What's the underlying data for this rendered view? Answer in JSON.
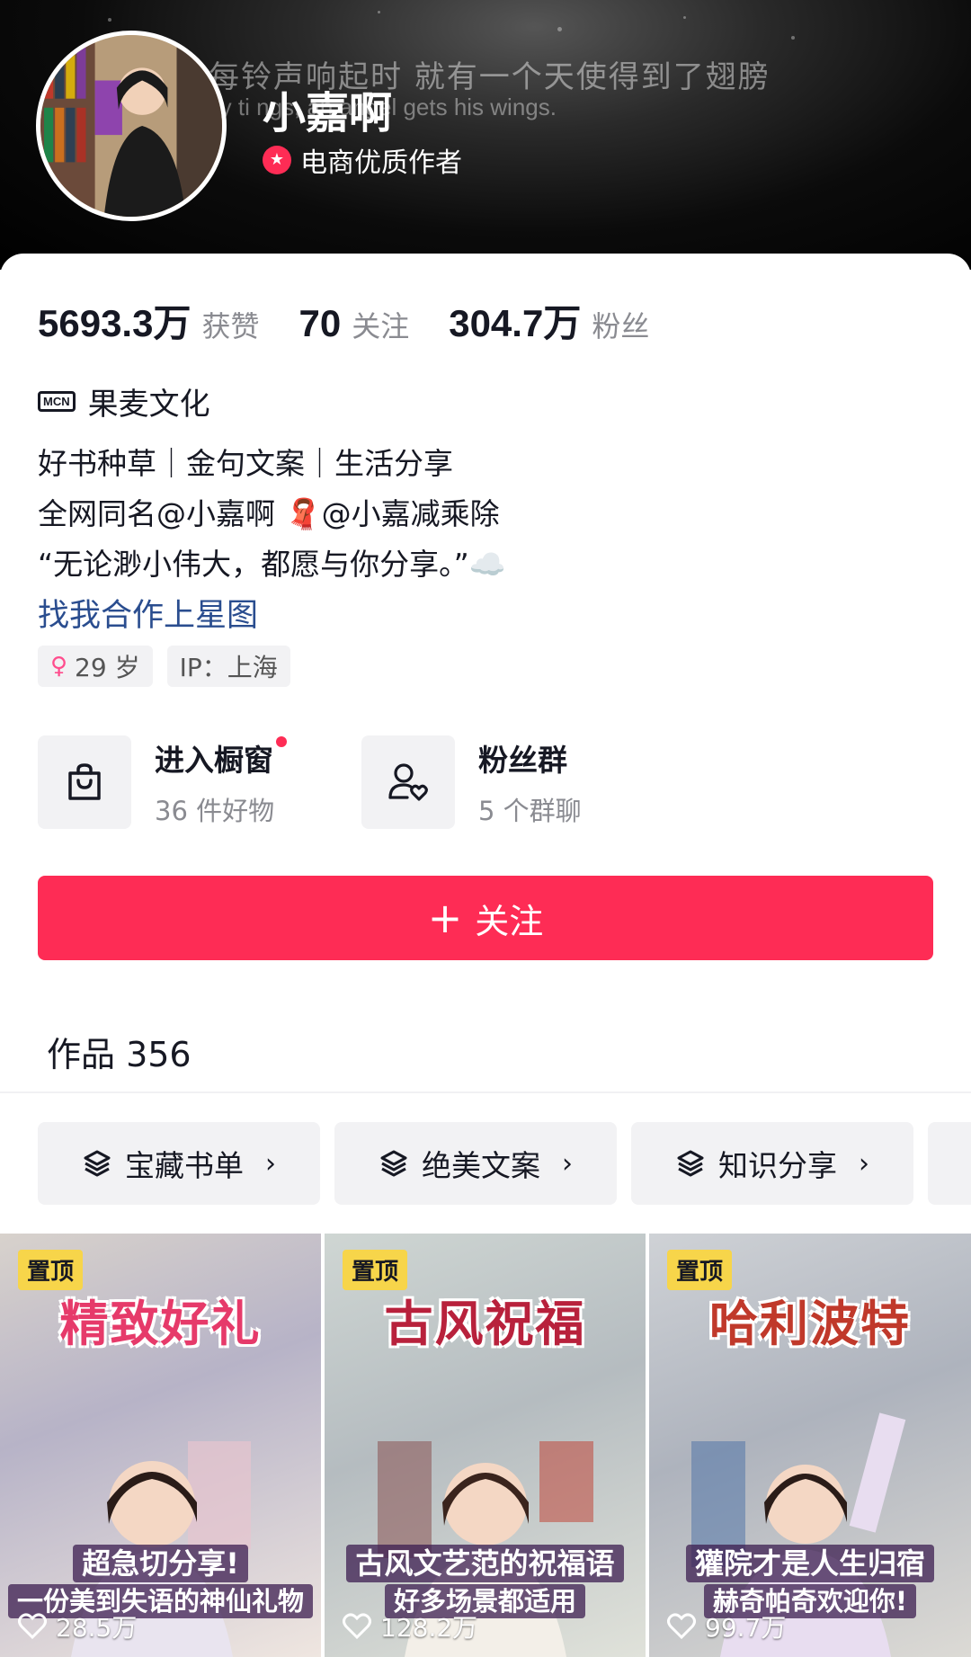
{
  "banner": {
    "line1": "每铃声响起时 就有一个天使得到了翅膀",
    "line2": "ry ti        ngs, an angel gets his wings."
  },
  "profile": {
    "nickname": "小嘉啊",
    "certification": "电商优质作者",
    "cert_icon": "star-badge-icon"
  },
  "stats": [
    {
      "num": "5693.3万",
      "label": "获赞"
    },
    {
      "num": "70",
      "label": "关注"
    },
    {
      "num": "304.7万",
      "label": "粉丝"
    }
  ],
  "mcn": {
    "badge": "MCN",
    "name": "果麦文化"
  },
  "bio": {
    "line1": "好书种草｜金句文案｜生活分享",
    "line2": "全网同名@小嘉啊 🧣@小嘉减乘除",
    "line3": "“无论渺小伟大，都愿与你分享。”☁️",
    "link": "找我合作上星图"
  },
  "tags": {
    "age": "29 岁",
    "ip": "IP：上海"
  },
  "services": {
    "shop": {
      "title": "进入橱窗",
      "sub": "36 件好物"
    },
    "fans": {
      "title": "粉丝群",
      "sub": "5 个群聊"
    }
  },
  "follow": {
    "label": "关注",
    "icon": "plus-icon"
  },
  "works": {
    "title": "作品 356"
  },
  "collections": [
    {
      "label": "宝藏书单"
    },
    {
      "label": "绝美文案"
    },
    {
      "label": "知识分享"
    }
  ],
  "videos": [
    {
      "pin": "置顶",
      "title": "精致好礼",
      "cap1": "超急切分享!",
      "cap2": "一份美到失语的神仙礼物",
      "likes": "28.5万"
    },
    {
      "pin": "置顶",
      "title": "古风祝福",
      "cap1": "古风文艺范的祝福语",
      "cap2": "好多场景都适用",
      "likes": "128.2万"
    },
    {
      "pin": "置顶",
      "title": "哈利波特",
      "cap1": "獾院才是人生归宿",
      "cap2": "赫奇帕奇欢迎你!",
      "likes": "99.7万"
    }
  ],
  "colors": {
    "accent": "#fe2c55",
    "link": "#2a4d8f",
    "muted": "#8a8b91"
  }
}
